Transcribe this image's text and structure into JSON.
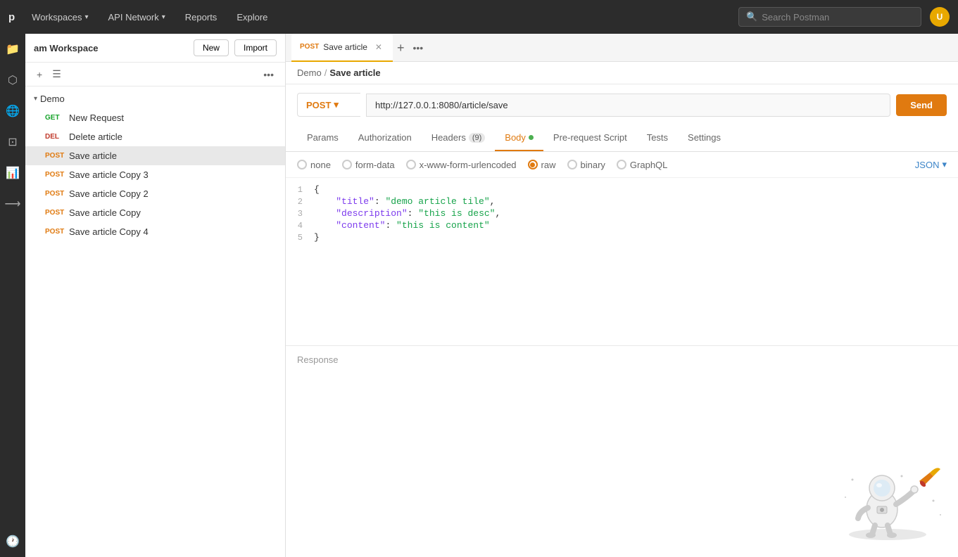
{
  "nav": {
    "workspaces_label": "Workspaces",
    "api_network_label": "API Network",
    "reports_label": "Reports",
    "explore_label": "Explore",
    "search_placeholder": "Search Postman",
    "avatar_initials": "U"
  },
  "sidebar": {
    "workspace_title": "am Workspace",
    "btn_new": "New",
    "btn_import": "Import",
    "collection_name": "Demo",
    "requests": [
      {
        "method": "GET",
        "name": "New Request",
        "active": false
      },
      {
        "method": "DEL",
        "name": "Delete article",
        "active": false
      },
      {
        "method": "POST",
        "name": "Save article",
        "active": true
      },
      {
        "method": "POST",
        "name": "Save article Copy 3",
        "active": false
      },
      {
        "method": "POST",
        "name": "Save article Copy 2",
        "active": false
      },
      {
        "method": "POST",
        "name": "Save article Copy",
        "active": false
      },
      {
        "method": "POST",
        "name": "Save article Copy 4",
        "active": false
      }
    ]
  },
  "tab": {
    "method": "POST",
    "name": "Save article"
  },
  "breadcrumb": {
    "parent": "Demo",
    "current": "Save article"
  },
  "request": {
    "method": "POST",
    "url": "http://127.0.0.1:8080/article/save",
    "send_label": "Send"
  },
  "sub_tabs": [
    {
      "label": "Params",
      "active": false,
      "badge": null,
      "dot": false
    },
    {
      "label": "Authorization",
      "active": false,
      "badge": null,
      "dot": false
    },
    {
      "label": "Headers",
      "active": false,
      "badge": "9",
      "dot": false
    },
    {
      "label": "Body",
      "active": true,
      "badge": null,
      "dot": true
    },
    {
      "label": "Pre-request Script",
      "active": false,
      "badge": null,
      "dot": false
    },
    {
      "label": "Tests",
      "active": false,
      "badge": null,
      "dot": false
    },
    {
      "label": "Settings",
      "active": false,
      "badge": null,
      "dot": false
    }
  ],
  "body_options": [
    {
      "id": "none",
      "label": "none",
      "selected": false
    },
    {
      "id": "form-data",
      "label": "form-data",
      "selected": false
    },
    {
      "id": "x-www-form-urlencoded",
      "label": "x-www-form-urlencoded",
      "selected": false
    },
    {
      "id": "raw",
      "label": "raw",
      "selected": true
    },
    {
      "id": "binary",
      "label": "binary",
      "selected": false
    },
    {
      "id": "graphql",
      "label": "GraphQL",
      "selected": false
    }
  ],
  "json_format": "JSON",
  "code_lines": [
    {
      "num": 1,
      "content": "{",
      "type": "brace"
    },
    {
      "num": 2,
      "content": "    \"title\": \"demo article tile\",",
      "type": "kv"
    },
    {
      "num": 3,
      "content": "    \"description\": \"this is desc\",",
      "type": "kv"
    },
    {
      "num": 4,
      "content": "    \"content\": \"this is content\"",
      "type": "kv"
    },
    {
      "num": 5,
      "content": "}",
      "type": "brace"
    }
  ],
  "response_label": "Response"
}
